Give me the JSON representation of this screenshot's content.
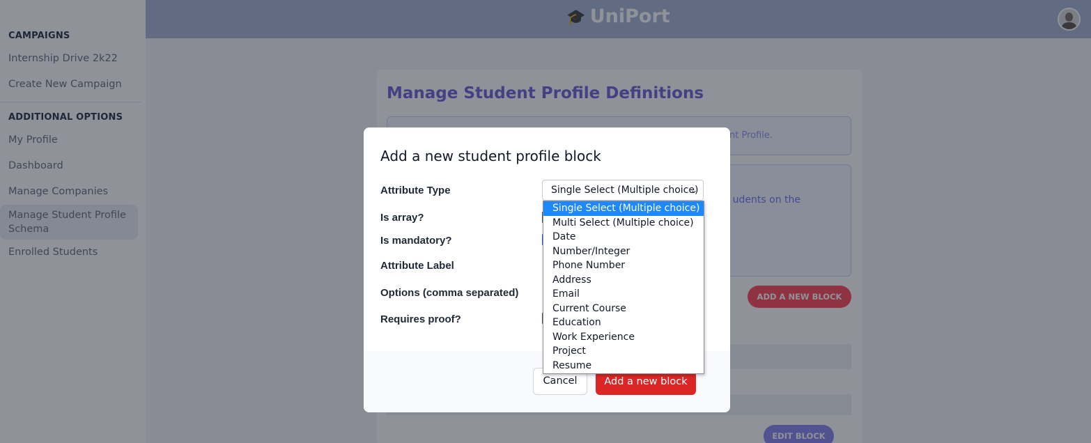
{
  "app": {
    "name": "UniPort",
    "logo_icon": "graduation-cap-icon"
  },
  "sidebar": {
    "sections": [
      {
        "heading": "CAMPAIGNS",
        "items": [
          "Internship Drive 2k22",
          "Create New Campaign"
        ]
      },
      {
        "heading": "ADDITIONAL OPTIONS",
        "items": [
          "My Profile",
          "Dashboard",
          "Manage Companies",
          "Manage Student Profile Schema",
          "Enrolled Students"
        ]
      }
    ],
    "active_item": "Manage Student Profile Schema"
  },
  "page": {
    "title": "Manage Student Profile Definitions",
    "info_text_partial": "nt Profile.",
    "info_text2_partial": "udents on the",
    "add_block_button": "ADD A NEW BLOCK",
    "edit_block_button": "EDIT BLOCK"
  },
  "modal": {
    "title": "Add a new student profile block",
    "labels": {
      "attribute_type": "Attribute Type",
      "is_array": "Is array?",
      "is_mandatory": "Is mandatory?",
      "attribute_label": "Attribute Label",
      "options": "Options (comma separated)",
      "requires_proof": "Requires proof?"
    },
    "attribute_type_value": "Single Select (Multiple choice)",
    "attribute_type_options": [
      "Single Select (Multiple choice)",
      "Multi Select (Multiple choice)",
      "Date",
      "Number/Integer",
      "Phone Number",
      "Address",
      "Email",
      "Current Course",
      "Education",
      "Work Experience",
      "Project",
      "Resume"
    ],
    "cancel_label": "Cancel",
    "submit_label": "Add a new block"
  },
  "colors": {
    "brand_purple": "#7265d6",
    "danger": "#dc2626",
    "select_highlight": "#1e88ff"
  }
}
